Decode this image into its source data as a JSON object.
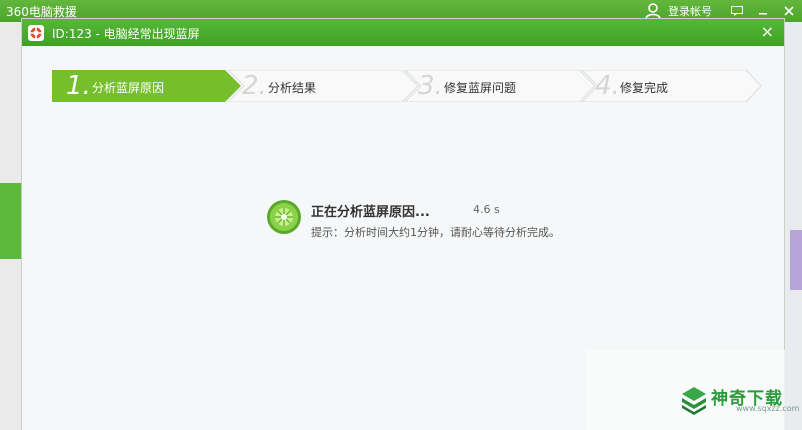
{
  "app": {
    "title": "360电脑救援",
    "login_label": "登录帐号"
  },
  "dialog": {
    "title": "ID:123 - 电脑经常出现蓝屏",
    "close_label": "×"
  },
  "steps": [
    {
      "num": "1.",
      "label": "分析蓝屏原因",
      "active": true
    },
    {
      "num": "2.",
      "label": "分析结果",
      "active": false
    },
    {
      "num": "3.",
      "label": "修复蓝屏问题",
      "active": false
    },
    {
      "num": "4.",
      "label": "修复完成",
      "active": false
    }
  ],
  "status": {
    "title": "正在分析蓝屏原因...",
    "time": "4.6 s",
    "hint": "提示：分析时间大约1分钟，请耐心等待分析完成。"
  },
  "watermark": {
    "brand": "神奇下载",
    "url": "www.sqxzz.com"
  },
  "colors": {
    "brand_green": "#4ea52d",
    "active_step": "#76bf2c"
  }
}
